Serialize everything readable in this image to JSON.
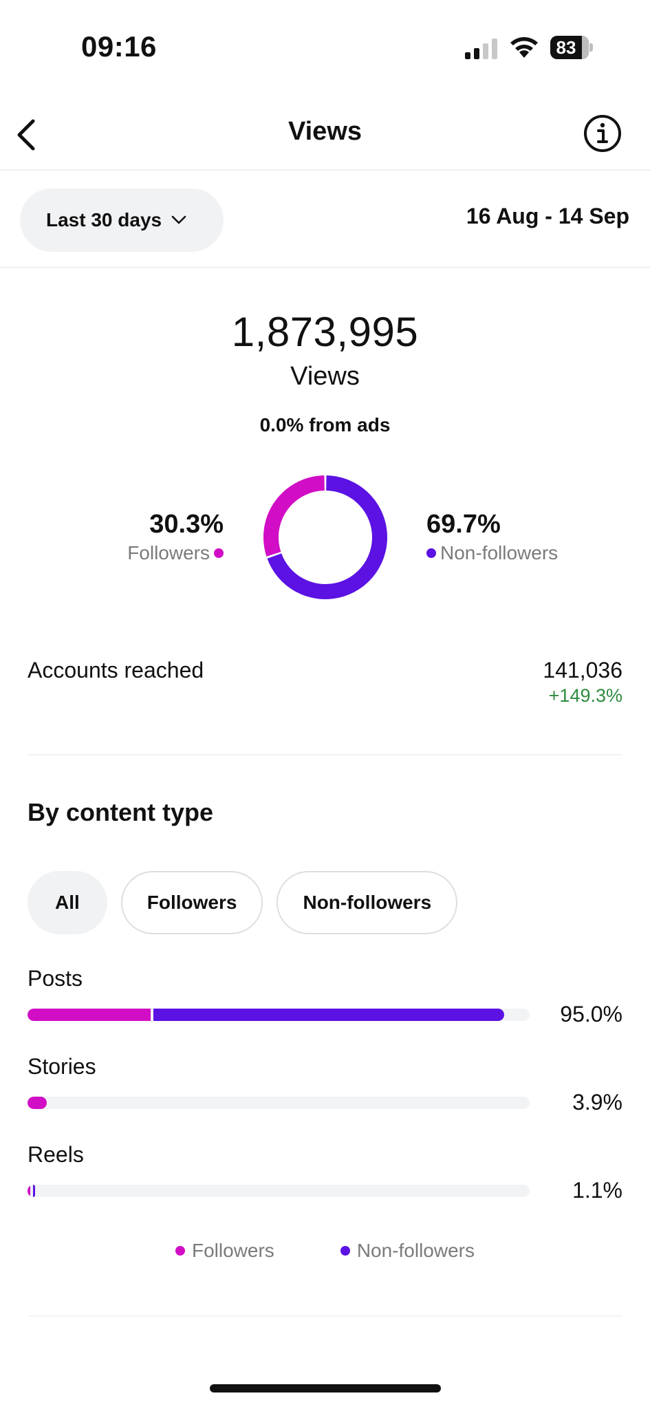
{
  "status_bar": {
    "time": "09:16",
    "battery": "83"
  },
  "header": {
    "title": "Views"
  },
  "filter": {
    "range_label": "Last 30 days",
    "date_range": "16 Aug - 14 Sep"
  },
  "summary": {
    "total_views": "1,873,995",
    "views_label": "Views",
    "ads_note": "0.0% from ads",
    "followers_pct": "30.3%",
    "followers_label": "Followers",
    "non_followers_pct": "69.7%",
    "non_followers_label": "Non-followers",
    "followers_share": 0.303,
    "non_followers_share": 0.697
  },
  "reach": {
    "label": "Accounts reached",
    "value": "141,036",
    "change": "+149.3%"
  },
  "content_type": {
    "title": "By content type",
    "tabs": [
      "All",
      "Followers",
      "Non-followers"
    ],
    "rows": [
      {
        "label": "Posts",
        "pct": "95.0%",
        "followers_share": 0.245,
        "non_followers_share": 0.705
      },
      {
        "label": "Stories",
        "pct": "3.9%",
        "followers_share": 0.039,
        "non_followers_share": 0.0
      },
      {
        "label": "Reels",
        "pct": "1.1%",
        "followers_share": 0.006,
        "non_followers_share": 0.005
      }
    ],
    "legend": {
      "followers": "Followers",
      "non_followers": "Non-followers"
    }
  },
  "colors": {
    "followers": "#d10ec5",
    "non_followers": "#5b12e3",
    "positive": "#2e8b3e"
  }
}
